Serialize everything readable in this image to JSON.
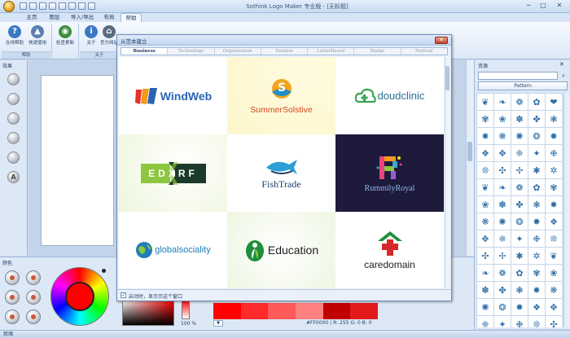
{
  "window": {
    "title": "Sothink Logo Maker 专业版 - [无标题]",
    "controls": {
      "minimize": "─",
      "maximize": "□",
      "close": "✕"
    }
  },
  "tabs": [
    {
      "label": "主页"
    },
    {
      "label": "图层"
    },
    {
      "label": "导入/导出"
    },
    {
      "label": "布局"
    },
    {
      "label": "帮助",
      "active": true
    }
  ],
  "ribbon": {
    "groups": [
      {
        "label": "帮助",
        "buttons": [
          {
            "label": "在线帮助",
            "icon": "help-icon",
            "glyph": "?",
            "color": "#3b78c4"
          },
          {
            "label": "快速使用",
            "icon": "quick-start-icon",
            "glyph": "▲",
            "color": "#5a7fb0"
          }
        ]
      },
      {
        "label": "",
        "buttons": [
          {
            "label": "检查更新",
            "icon": "update-icon",
            "glyph": "◉",
            "color": "#3e8f3e"
          }
        ]
      },
      {
        "label": "关于",
        "buttons": [
          {
            "label": "关于",
            "icon": "info-icon",
            "glyph": "i",
            "color": "#3b78c4"
          },
          {
            "label": "官方网站",
            "icon": "home-icon",
            "glyph": "⌂",
            "color": "#5b6b80"
          }
        ]
      }
    ]
  },
  "left_panel": {
    "title": "效果",
    "letter_effect": "A"
  },
  "color_panel": {
    "title": "颜色",
    "alpha": "100 %",
    "hex": "#FF0000",
    "r_label": "R:",
    "r": "255",
    "g_label": "G:",
    "g": "0",
    "b_label": "B:",
    "b": "0"
  },
  "palette": [
    "#ff0000",
    "#ff2a2a",
    "#ff5a5a",
    "#ff8080",
    "#c00000",
    "#e31a1a"
  ],
  "resource_panel": {
    "title": "资源",
    "combo": "Pattern",
    "icons": [
      "❦",
      "❧",
      "❁",
      "✿",
      "❤",
      "✾",
      "❀",
      "✽",
      "✤",
      "❃",
      "✸",
      "❋",
      "✺",
      "❂",
      "✹",
      "❖",
      "✥",
      "❈",
      "✦",
      "❉",
      "❊",
      "✣",
      "✢",
      "✱",
      "✲",
      "❦",
      "❧",
      "❁",
      "✿",
      "✾",
      "❀",
      "✽",
      "✤",
      "❃",
      "✸",
      "❋",
      "✺",
      "❂",
      "✹",
      "❖",
      "✥",
      "❈",
      "✦",
      "❉",
      "❊",
      "✣",
      "✢",
      "✱",
      "✲",
      "❦",
      "❧",
      "❁",
      "✿",
      "✾",
      "❀",
      "✽",
      "✤",
      "❃",
      "✸",
      "❋",
      "✺",
      "❂",
      "✹",
      "❖",
      "✥",
      "❈",
      "✦",
      "❉",
      "❊",
      "✣"
    ],
    "icon_color": "#2f6fa8"
  },
  "dialog": {
    "title": "从范本建立",
    "tabs": [
      {
        "label": "Business",
        "active": true
      },
      {
        "label": "Technology"
      },
      {
        "label": "Organization"
      },
      {
        "label": "Fashion"
      },
      {
        "label": "LetterBased"
      },
      {
        "label": "Badge"
      },
      {
        "label": "Festival"
      }
    ],
    "logos": [
      {
        "id": "windweb",
        "text": "WindWeb",
        "color": "#2a63b4"
      },
      {
        "id": "summersolstive",
        "text": "SummerSolstive",
        "color": "#1f8fc6"
      },
      {
        "id": "doudclinic",
        "text": "doudclinic",
        "color": "#2a6f8f"
      },
      {
        "id": "edxrf",
        "text": "EDXRF",
        "color": "#1c3a2a"
      },
      {
        "id": "fishtrade",
        "text": "FishTrade",
        "color": "#1f3f64"
      },
      {
        "id": "rummilyroyal",
        "text": "RummilyRoyal",
        "color": "#8fb8e8"
      },
      {
        "id": "globalsociality",
        "text": "globalsociality",
        "color": "#1f7db8"
      },
      {
        "id": "education",
        "text": "Education",
        "color": "#1d1d1d"
      },
      {
        "id": "caredomain",
        "text": "caredomain",
        "color": "#222222"
      }
    ],
    "startup_checkbox": "启动时，显示示这个窗口"
  },
  "status": {
    "text": "就绪"
  }
}
